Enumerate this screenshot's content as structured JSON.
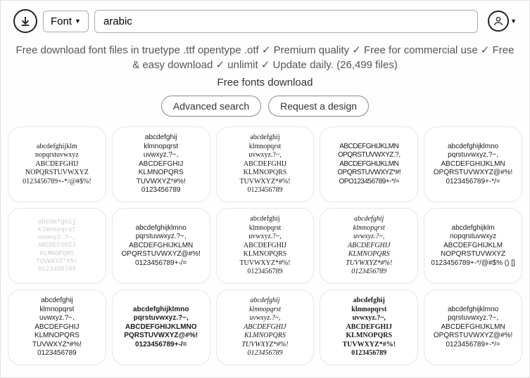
{
  "topbar": {
    "dropdown_label": "Font",
    "search_value": "arabic"
  },
  "tagline": "Free download font files in truetype .ttf opentype .otf ✓ Premium quality ✓ Free for commercial use ✓ Free & easy download ✓ unlimit ✓ Update daily. (26,499 files)",
  "subtitle": "Free fonts download",
  "buttons": {
    "advanced": "Advanced search",
    "request": "Request a design"
  },
  "cards": [
    {
      "style": "f-cursive",
      "text": "abcdefghijklm\nnopqrstuvwxyz\nABCDEFGHIJ\nNOPQRSTUVWXYZ\n0123456789+-*/@#$%!"
    },
    {
      "style": "",
      "text": "abcdefghij\nklmnopqrst\nuvwxyz.?~,\nABCDEFGHIJ\nKLMNOPQRS\nTUVWXYZ*#%!\n0123456789"
    },
    {
      "style": "f-cursive",
      "text": "abcdefghij\nklmnopqrst\nuvwxyz.?~,\nABCDEFGHIJ\nKLMNOPQRS\nTUVWXYZ*#%!\n0123456789"
    },
    {
      "style": "f-narrow",
      "text": "ABCDEFGHIJKLMN\nOPQRSTUVWXYZ.?,\nABCDEFGHIJKLMN\nOPQRSTUVWXYZ*#!\nOPO123456789+-*/="
    },
    {
      "style": "",
      "text": "abcdefghijklmno\npqrstuvwxyz.?~,\nABCDEFGHIJKLMN\nOPQRSTUVWXYZ@#%!\n0123456789+-*/="
    },
    {
      "style": "f-mono faded",
      "text": "abcdefghij\nklmnopqrst\nuvwxyz.?~,\nABCDEFGHIJ\nKLMNOPQRS\nTUVWXYZ*#%!\n0123456789"
    },
    {
      "style": "",
      "text": "abcdefghijklmno\npqrstuvwxyz.?~,\nABCDEFGHIJKLMN\nOPQRSTUVWXYZ@#%!\n0123456789+-/="
    },
    {
      "style": "f-serif",
      "text": "abcdefghij\nklmnopqrst\nuvwxyz.?~,\nABCDEFGHIJ\nKLMNOPQRS\nTUVWXYZ*#%!\n0123456789"
    },
    {
      "style": "f-italic",
      "text": "abcdefghij\nklmnopqrst\nuvwxyz.?~,\nABCDEFGHIJ\nKLMNOPQRS\nTUVWXYZ*#%!\n0123456789"
    },
    {
      "style": "",
      "text": "abcdefghijklm\nnopqrstuvwxyz\nABCDEFGHIJKLM\nNOPQRSTUVWXYZ\n0123456789+-*/@#$% () []"
    },
    {
      "style": "",
      "text": "abcdefghij\nklmnopqrst\nuvwxyz.?~,\nABCDEFGHIJ\nKLMNOPQRS\nTUVWXYZ*#%!\n0123456789"
    },
    {
      "style": "f-bold",
      "text": "abcdefghijklmno\npqrstuvwxyz.?~,\nABCDEFGHIJKLMNO\nPQRSTUVWXYZ@#%!\n0123456789+-/="
    },
    {
      "style": "f-italic",
      "text": "abcdefghij\nklmnopqrst\nuvwxyz.?~,\nABCDEFGHIJ\nKLMNOPQRS\nTUVWXYZ*#%!\n0123456789"
    },
    {
      "style": "f-slab",
      "text": "abcdefghij\nklmnopqrst\nuvwxyz.?~,\nABCDEFGHIJ\nKLMNOPQRS\nTUVWXYZ*#%!\n0123456789"
    },
    {
      "style": "",
      "text": "abcdefghijklmno\npqrstuvwxyz.?~,\nABCDEFGHIJKLMN\nOPQRSTUVWXYZ@#%!\n0123456789+-*/="
    }
  ]
}
